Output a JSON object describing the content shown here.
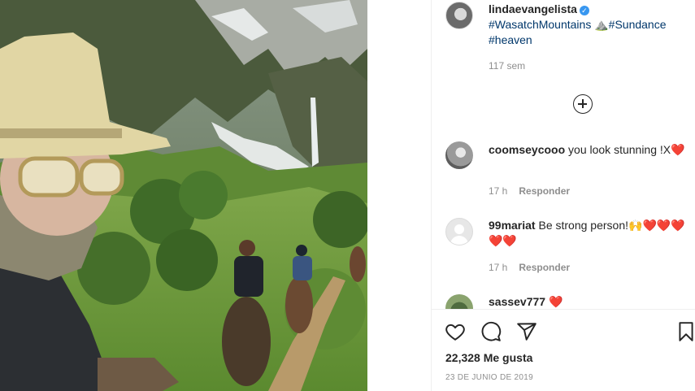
{
  "post": {
    "owner": "linda evangelista",
    "owner_handle": "lindaevangelista",
    "caption": {
      "tag1": "#WasatchMountains",
      "emoji": "⛰️",
      "tag2": "#Sundance",
      "tag3": "#heaven"
    },
    "age": "117 sem"
  },
  "comments": [
    {
      "user": "coomseycooo",
      "text": "you look stunning !X",
      "hearts": "❤️",
      "time": "17 h",
      "reply": "Responder"
    },
    {
      "user": "99mariat",
      "text": "Be strong person!",
      "emoji": "🙌",
      "hearts": "❤️❤️❤️❤️❤️",
      "time": "17 h",
      "reply": "Responder"
    },
    {
      "user": "sassev777",
      "hearts": "❤️"
    }
  ],
  "footer": {
    "likes": "22,328 Me gusta",
    "date": "23 DE JUNIO DE 2019"
  },
  "icons": {
    "like": "heart-outline-icon",
    "comment": "speech-bubble-icon",
    "share": "paper-plane-icon",
    "save": "bookmark-icon",
    "load_more": "plus-circle-icon"
  },
  "colors": {
    "link": "#00376b",
    "muted": "#8e8e8e",
    "verified": "#3897f0",
    "heart": "#ed4956"
  }
}
